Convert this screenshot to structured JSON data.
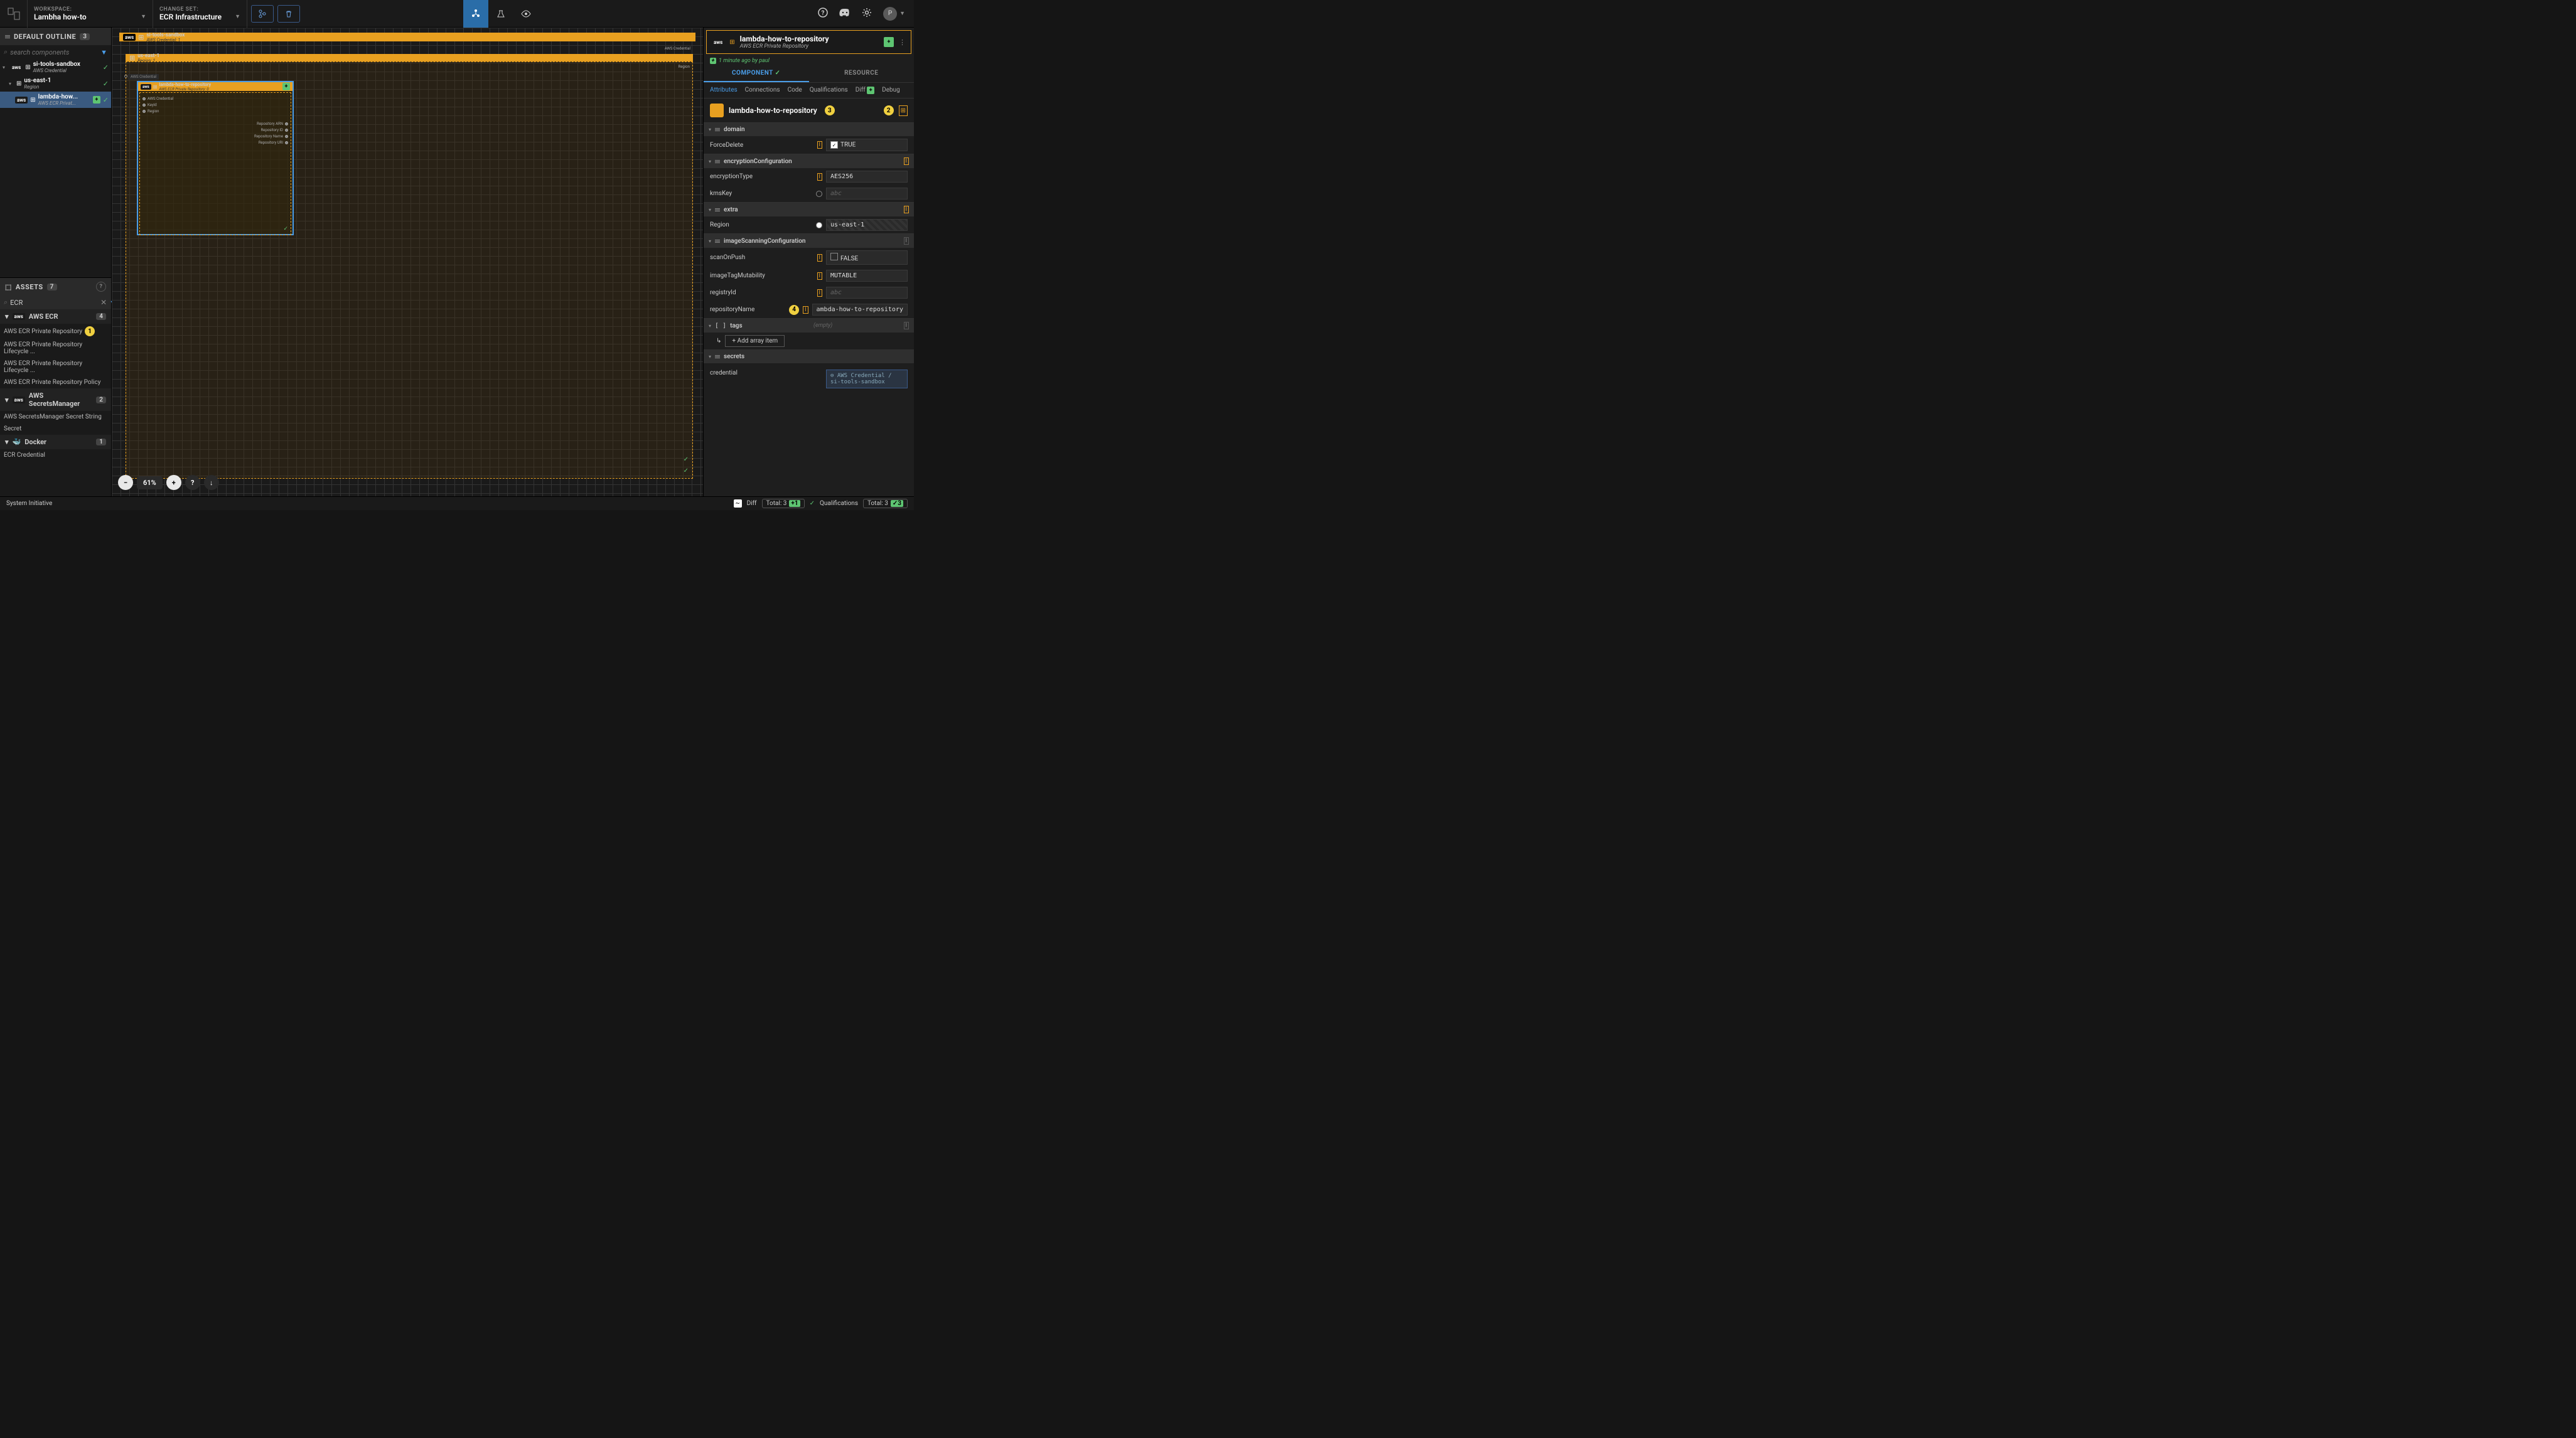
{
  "topbar": {
    "workspace_label": "WORKSPACE:",
    "workspace": "Lambha how-to",
    "changeset_label": "CHANGE SET:",
    "changeset": "ECR Infrastructure"
  },
  "outline": {
    "title": "DEFAULT OUTLINE",
    "count": "3",
    "search_placeholder": "search components",
    "items": [
      {
        "name": "si-tools-sandbox",
        "sub": "AWS Credential"
      },
      {
        "name": "us-east-1",
        "sub": "Region"
      },
      {
        "name": "lambda-how...",
        "sub": "AWS ECR Privat..."
      }
    ]
  },
  "assets": {
    "title": "ASSETS",
    "count": "7",
    "search": "ECR",
    "groups": [
      {
        "name": "AWS ECR",
        "count": "4",
        "icon": "aws",
        "items": [
          "AWS ECR Private Repository",
          "AWS ECR Private Repository Lifecycle ...",
          "AWS ECR Private Repository Lifecycle ...",
          "AWS ECR Private Repository Policy"
        ]
      },
      {
        "name": "AWS SecretsManager",
        "count": "2",
        "icon": "aws",
        "items": [
          "AWS SecretsManager Secret String",
          "Secret"
        ]
      },
      {
        "name": "Docker",
        "count": "1",
        "icon": "docker",
        "items": [
          "ECR Credential"
        ]
      }
    ]
  },
  "canvas": {
    "outer": {
      "name": "si-tools-sandbox",
      "sub": "AWS Credential: 1"
    },
    "region": {
      "name": "us-east-1",
      "sub": "Region: 1",
      "corner_aws": "AWS Credential",
      "corner_region": "Region"
    },
    "inner": {
      "name": "lambda-how-to-repository",
      "sub": "AWS ECR Private Repository: 0",
      "left_dots": [
        "AWS Credential",
        "KeyId",
        "Region"
      ],
      "right_dots": [
        "Repository ARN",
        "Repository ID",
        "Repository Name",
        "Repository URI"
      ]
    },
    "awscred_bar": "AWS Credential",
    "zoom": "61%"
  },
  "right": {
    "name": "lambda-how-to-repository",
    "sub": "AWS ECR Private Repository",
    "time": "1 minute ago by paul",
    "tabs": {
      "component": "COMPONENT",
      "resource": "RESOURCE"
    },
    "subtabs": [
      "Attributes",
      "Connections",
      "Code",
      "Qualifications",
      "Diff",
      "Debug"
    ],
    "name_field": "lambda-how-to-repository",
    "groups": {
      "domain": {
        "label": "domain",
        "rows": [
          {
            "name": "ForceDelete",
            "val": "TRUE",
            "type": "check_on"
          }
        ]
      },
      "enc": {
        "label": "encryptionConfiguration",
        "rows": [
          {
            "name": "encryptionType",
            "val": "AES256",
            "type": "text"
          },
          {
            "name": "kmsKey",
            "val": "abc",
            "type": "empty_sock"
          }
        ]
      },
      "extra": {
        "label": "extra",
        "rows": [
          {
            "name": "Region",
            "val": "us-east-1",
            "type": "diag_sock"
          }
        ]
      },
      "scan": {
        "label": "imageScanningConfiguration",
        "rows": [
          {
            "name": "scanOnPush",
            "val": "FALSE",
            "type": "check_off"
          }
        ]
      },
      "loose": [
        {
          "name": "imageTagMutability",
          "val": "MUTABLE",
          "type": "text"
        },
        {
          "name": "registryId",
          "val": "abc",
          "type": "empty"
        },
        {
          "name": "repositoryName",
          "val": "ambda-how-to-repository",
          "type": "text",
          "badge": "4"
        }
      ],
      "tags": {
        "label": "tags",
        "empty": "(empty)",
        "add": "Add array item"
      },
      "secrets": {
        "label": "secrets"
      },
      "credential": {
        "name": "credential",
        "val": "⊖ AWS Credential / si-tools-sandbox"
      }
    }
  },
  "footer": {
    "brand": "System Initiative",
    "diff": "Diff",
    "total": "Total: 3",
    "plus": "1",
    "qual": "Qualifications",
    "qtotal": "Total: 3",
    "qok": "3"
  },
  "badges": {
    "b1": "1",
    "b2": "2",
    "b3": "3",
    "b4": "4"
  }
}
